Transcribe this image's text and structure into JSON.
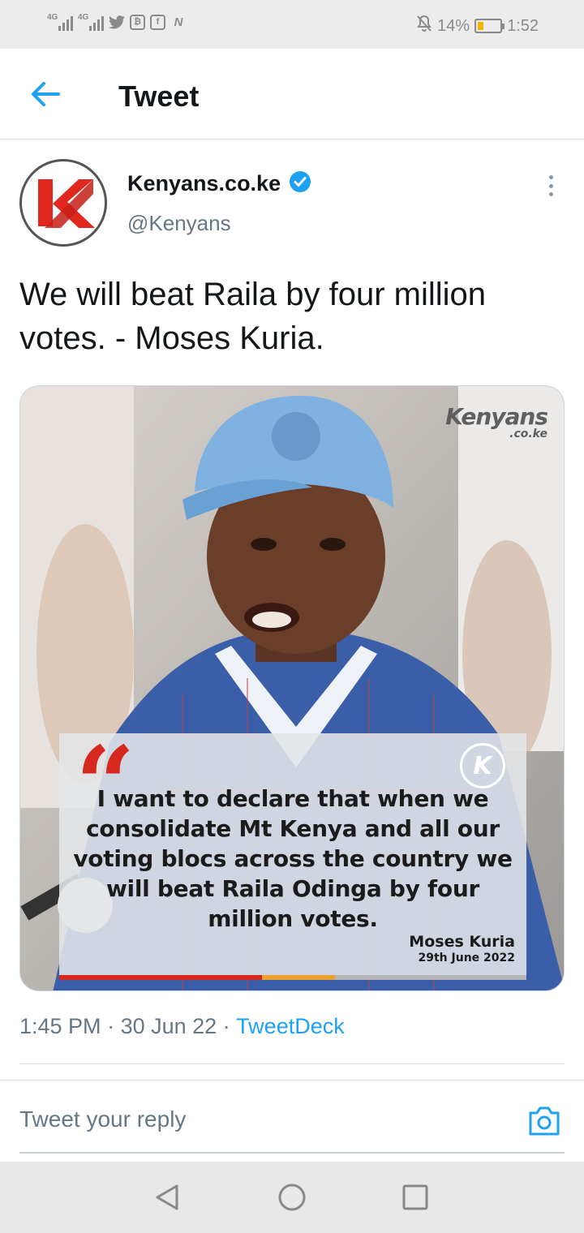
{
  "status_bar": {
    "network_1": "4G",
    "network_2": "4G",
    "battery_percent": "14%",
    "time": "1:52",
    "notification_icons": [
      "twitter-icon",
      "bitcoin-icon",
      "flipboard-icon",
      "n-icon"
    ]
  },
  "header": {
    "title": "Tweet"
  },
  "tweet": {
    "author_name": "Kenyans.co.ke",
    "author_handle": "@Kenyans",
    "verified": true,
    "text": "We will beat Raila by four million votes. - Moses Kuria.",
    "media": {
      "logo_main": "Kenyans",
      "logo_sub": ".co.ke",
      "quote_mark": "“",
      "badge_letter": "K",
      "quote": "I want to declare that when we consolidate Mt Kenya and all our voting blocs across the country we will beat Raila Odinga by four million votes.",
      "quote_author": "Moses Kuria",
      "quote_date": "29th June 2022"
    },
    "time": "1:45 PM",
    "separator": " · ",
    "date": "30 Jun 22",
    "source": "TweetDeck"
  },
  "reply": {
    "placeholder": "Tweet your reply"
  },
  "colors": {
    "accent": "#1da1f2",
    "secondary_text": "#657786",
    "quote_red": "#d6281f",
    "bar_orange": "#f0a22e",
    "bar_grey": "#b5b5b5"
  }
}
